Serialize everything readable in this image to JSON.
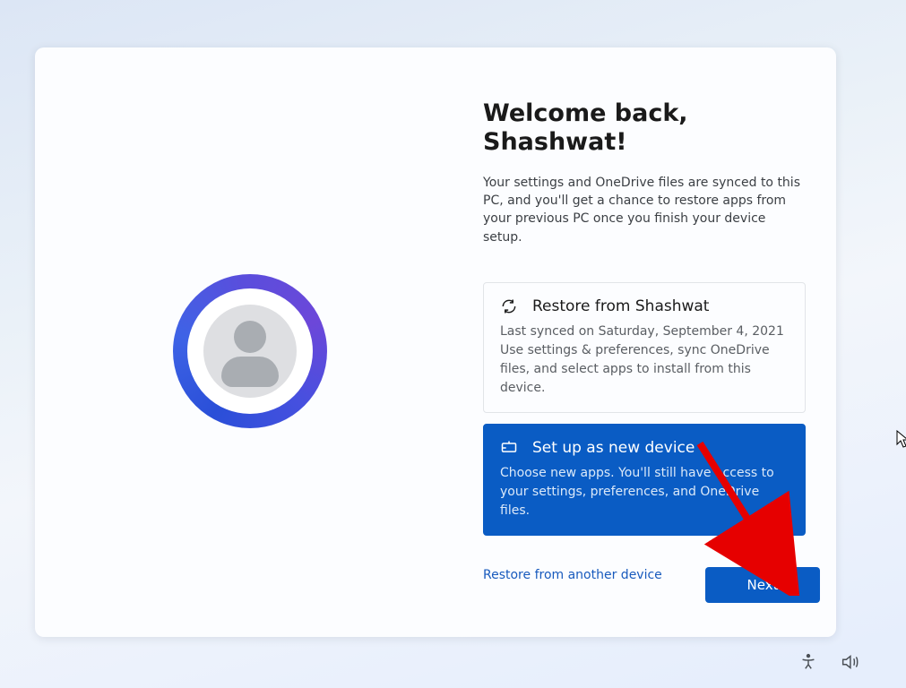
{
  "header": {
    "title": "Welcome back, Shashwat!",
    "subtitle": "Your settings and OneDrive files are synced to this PC, and you'll get a chance to restore apps from your previous PC once you finish your device setup."
  },
  "options": {
    "restore": {
      "title": "Restore from Shashwat",
      "description": "Last synced on Saturday, September 4, 2021\nUse settings & preferences, sync OneDrive files, and select apps to install from this device.",
      "selected": false
    },
    "new_device": {
      "title": "Set up as new device",
      "description": "Choose new apps. You'll still have access to your settings, preferences, and OneDrive files.",
      "selected": true
    }
  },
  "links": {
    "restore_other": "Restore from another device"
  },
  "actions": {
    "next": "Next"
  },
  "tray": {
    "accessibility_icon": "accessibility",
    "volume_icon": "volume"
  }
}
